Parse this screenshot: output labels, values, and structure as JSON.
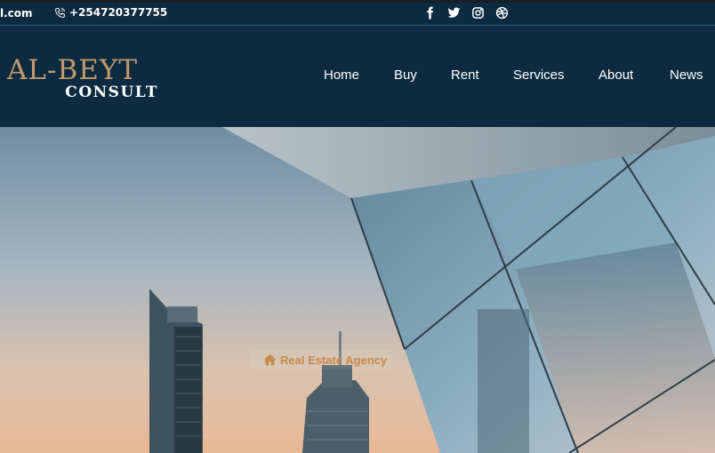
{
  "topbar": {
    "email": "l.com",
    "phone": "+254720377755",
    "social": [
      {
        "icon": "facebook-icon"
      },
      {
        "icon": "twitter-icon"
      },
      {
        "icon": "instagram-icon"
      },
      {
        "icon": "dribbble-icon"
      }
    ]
  },
  "logo": {
    "line1": "AL-BEYT",
    "line2": "CONSULT"
  },
  "nav": [
    {
      "label": "Home"
    },
    {
      "label": "Buy"
    },
    {
      "label": "Rent"
    },
    {
      "label": "Services"
    },
    {
      "label": "About"
    },
    {
      "label": "News"
    }
  ],
  "hero": {
    "badge": "Real Estate Agency"
  },
  "colors": {
    "navy": "#0c2b40",
    "gold": "#c29a6a",
    "badge_text": "#c9894a"
  }
}
